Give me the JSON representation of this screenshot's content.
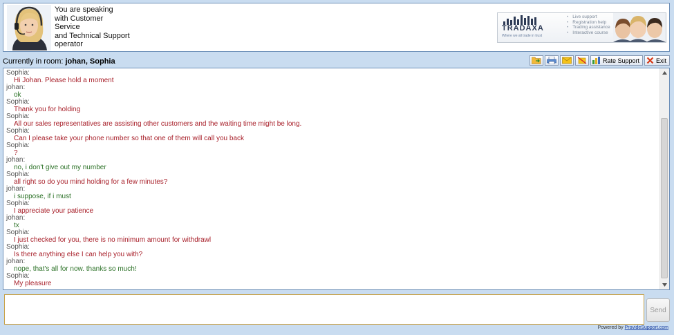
{
  "header": {
    "speaking_lines": [
      "You are speaking",
      "with Customer Service",
      "and Technical Support",
      "operator"
    ],
    "banner": {
      "brand": "TRADAXA",
      "tagline": "Where we all trade in trust",
      "services": [
        "Live support",
        "Registration help",
        "Trading assistance",
        "Interactive course"
      ]
    }
  },
  "room": {
    "label": "Currently in room:",
    "participants": "johan, Sophia"
  },
  "toolbar": {
    "rate_label": "Rate Support",
    "exit_label": "Exit"
  },
  "transcript": [
    {
      "sender": "Sophia:",
      "role": "op",
      "text": "Hi Johan. Please hold a moment"
    },
    {
      "sender": "johan:",
      "role": "visitor",
      "text": "ok"
    },
    {
      "sender": "Sophia:",
      "role": "op",
      "text": "Thank you for holding"
    },
    {
      "sender": "Sophia:",
      "role": "op",
      "text": "All our sales representatives are assisting other customers and the waiting time might be long."
    },
    {
      "sender": "Sophia:",
      "role": "op",
      "text": "Can I please take your phone number so that one of them will call you back"
    },
    {
      "sender": "Sophia:",
      "role": "op",
      "text": "?"
    },
    {
      "sender": "johan:",
      "role": "visitor",
      "text": "no, i don't give out my number"
    },
    {
      "sender": "Sophia:",
      "role": "op",
      "text": "all right so do you mind holding for a few minutes?"
    },
    {
      "sender": "johan:",
      "role": "visitor",
      "text": "i suppose, if i must"
    },
    {
      "sender": "Sophia:",
      "role": "op",
      "text": "I appreciate your patience"
    },
    {
      "sender": "johan:",
      "role": "visitor",
      "text": "tx"
    },
    {
      "sender": "Sophia:",
      "role": "op",
      "text": "I just checked for you, there is no minimum amount for withdrawl"
    },
    {
      "sender": "Sophia:",
      "role": "op",
      "text": "Is there anything else I can help you with?"
    },
    {
      "sender": "johan:",
      "role": "visitor",
      "text": "nope, that's all for now.  thanks so much!"
    },
    {
      "sender": "Sophia:",
      "role": "op",
      "text": "My pleasure"
    }
  ],
  "composer": {
    "value": "",
    "send_label": "Send"
  },
  "footer": {
    "powered_by": "Powered by",
    "link_text": "ProvideSupport.com"
  },
  "colors": {
    "operator_text": "#a8202a",
    "visitor_text": "#2a7025",
    "frame_border": "#6d8fb8",
    "page_bg": "#c9dcf0"
  }
}
